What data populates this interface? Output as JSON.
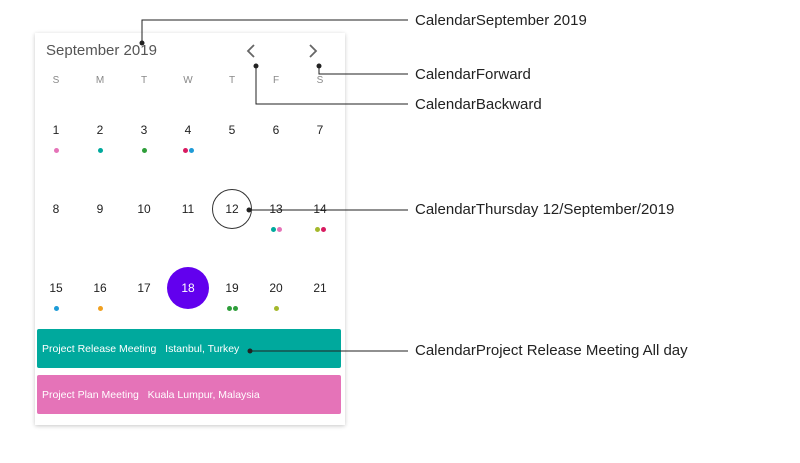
{
  "calendar": {
    "month_title": "September 2019",
    "weekdays": [
      "S",
      "M",
      "T",
      "W",
      "T",
      "F",
      "S"
    ],
    "weeks": [
      [
        {
          "day": "1",
          "dots": [
            "#e573b8"
          ]
        },
        {
          "day": "2",
          "dots": [
            "#00a99d"
          ]
        },
        {
          "day": "3",
          "dots": [
            "#2e9e3a"
          ]
        },
        {
          "day": "4",
          "dots": [
            "#d81b60",
            "#1e9bd7"
          ]
        },
        {
          "day": "5",
          "dots": []
        },
        {
          "day": "6",
          "dots": []
        },
        {
          "day": "7",
          "dots": []
        }
      ],
      [
        {
          "day": "8",
          "dots": []
        },
        {
          "day": "9",
          "dots": []
        },
        {
          "day": "10",
          "dots": []
        },
        {
          "day": "11",
          "dots": []
        },
        {
          "day": "12",
          "dots": [],
          "today": true
        },
        {
          "day": "13",
          "dots": [
            "#00a99d",
            "#e573b8"
          ]
        },
        {
          "day": "14",
          "dots": [
            "#a4b82c",
            "#d81b60"
          ]
        }
      ],
      [
        {
          "day": "15",
          "dots": [
            "#1e9bd7"
          ]
        },
        {
          "day": "16",
          "dots": [
            "#f0a020"
          ]
        },
        {
          "day": "17",
          "dots": []
        },
        {
          "day": "18",
          "dots": [],
          "selected": true
        },
        {
          "day": "19",
          "dots": [
            "#2e9e3a",
            "#2e9e3a"
          ]
        },
        {
          "day": "20",
          "dots": [
            "#a4b82c"
          ]
        },
        {
          "day": "21",
          "dots": []
        }
      ]
    ],
    "events": [
      {
        "title": "Project Release Meeting",
        "location": "Istanbul, Turkey"
      },
      {
        "title": "Project Plan Meeting",
        "location": "Kuala Lumpur, Malaysia"
      }
    ],
    "colors": {
      "selected": "#6200ee",
      "event_1": "#00a99d",
      "event_2": "#e573b8"
    }
  },
  "callouts": [
    {
      "label": "CalendarSeptember 2019"
    },
    {
      "label": "CalendarForward"
    },
    {
      "label": "CalendarBackward"
    },
    {
      "label": "CalendarThursday 12/September/2019"
    },
    {
      "label": "CalendarProject Release Meeting All day"
    }
  ]
}
